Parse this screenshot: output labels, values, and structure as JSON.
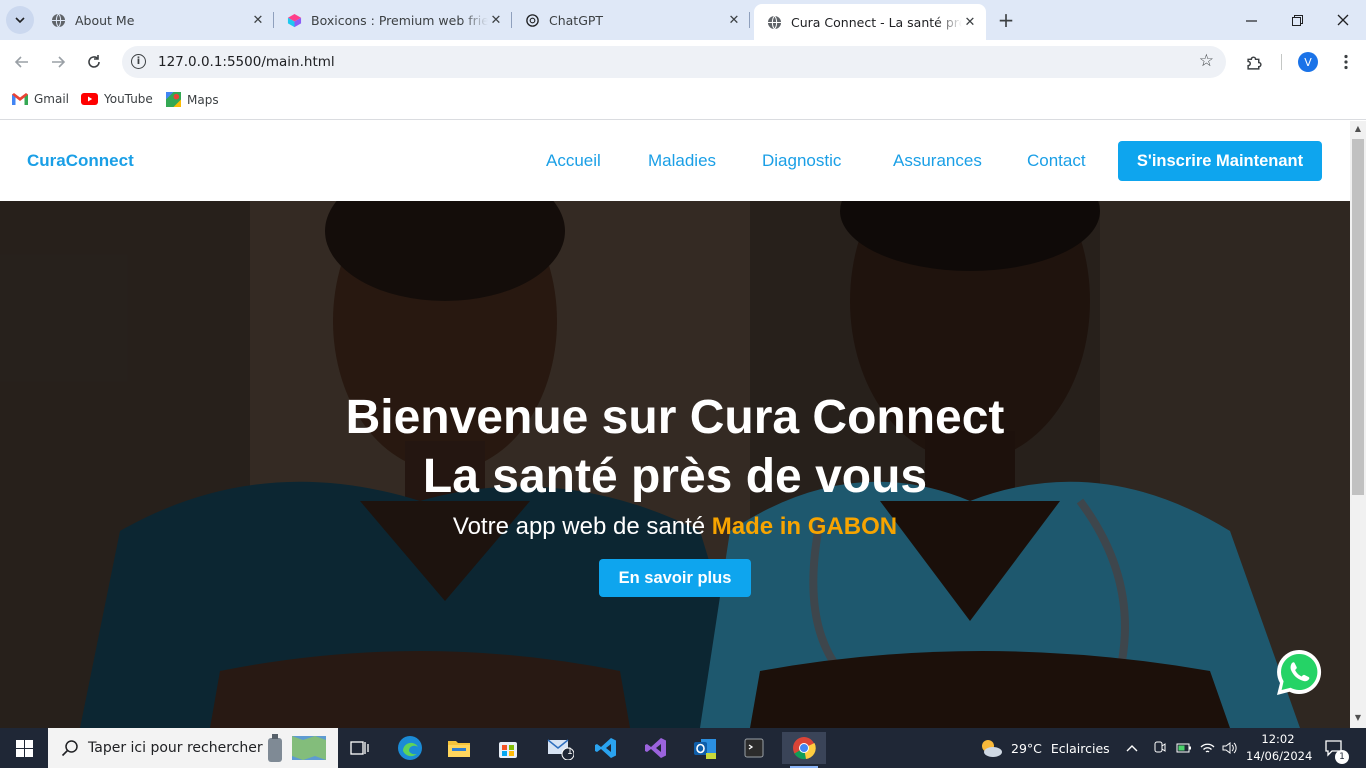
{
  "browser": {
    "tabs": [
      {
        "title": "About Me",
        "favicon": "globe-icon"
      },
      {
        "title": "Boxicons : Premium web friendly",
        "favicon": "boxicons-icon"
      },
      {
        "title": "ChatGPT",
        "favicon": "chatgpt-icon"
      },
      {
        "title": "Cura Connect - La santé près de",
        "favicon": "globe-icon",
        "active": true
      }
    ],
    "url": "127.0.0.1:5500/main.html",
    "profile_initial": "V",
    "bookmarks": [
      {
        "label": "Gmail",
        "icon": "gmail-icon"
      },
      {
        "label": "YouTube",
        "icon": "youtube-icon"
      },
      {
        "label": "Maps",
        "icon": "maps-icon"
      }
    ]
  },
  "site": {
    "brand": "CuraConnect",
    "nav": [
      {
        "label": "Accueil"
      },
      {
        "label": "Maladies"
      },
      {
        "label": "Diagnostic"
      },
      {
        "label": "Assurances"
      },
      {
        "label": "Contact"
      }
    ],
    "cta": "S'inscrire Maintenant",
    "hero": {
      "line1": "Bienvenue sur Cura Connect",
      "line2": "La santé près de vous",
      "subtitle_prefix": "Votre app web de santé ",
      "subtitle_highlight": "Made in GABON",
      "button": "En savoir plus"
    },
    "colors": {
      "accent": "#0ea5ee",
      "highlight": "#f7a400",
      "whatsapp": "#25d366"
    }
  },
  "taskbar": {
    "search_placeholder": "Taper ici pour rechercher",
    "weather": {
      "temp": "29°C",
      "condition": "Eclaircies"
    },
    "time": "12:02",
    "date": "14/06/2024",
    "notification_count": "1",
    "mail_badge": "1"
  }
}
